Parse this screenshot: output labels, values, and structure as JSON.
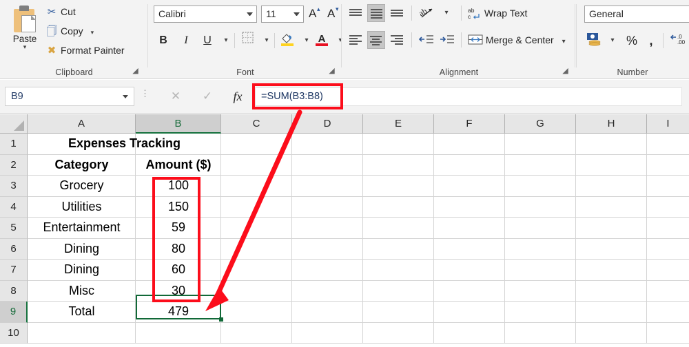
{
  "ribbon": {
    "clipboard": {
      "group_label": "Clipboard",
      "paste_label": "Paste",
      "paste_icon": "clipboard-icon",
      "items": [
        {
          "label": "Cut",
          "icon": "scissors-icon",
          "has_caret": false
        },
        {
          "label": "Copy",
          "icon": "copy-icon",
          "has_caret": true
        },
        {
          "label": "Format Painter",
          "icon": "paintbrush-icon",
          "has_caret": false
        }
      ]
    },
    "font": {
      "group_label": "Font",
      "font_name": "Calibri",
      "font_size": "11",
      "grow_font": "A",
      "shrink_font": "A",
      "bold": "B",
      "italic": "I",
      "underline": "U",
      "borders_icon": "borders-icon",
      "fill_color_icon": "fill-color-icon",
      "font_color_letter": "A",
      "fill_color": "#ffd320",
      "font_color": "#e81123"
    },
    "alignment": {
      "group_label": "Alignment",
      "wrap_text": "Wrap Text",
      "merge_center": "Merge & Center",
      "wrap_icon": "wrap-text-icon",
      "merge_icon": "merge-cells-icon",
      "orientation_icon": "text-orientation-icon",
      "decrease_indent_icon": "decrease-indent-icon",
      "increase_indent_icon": "increase-indent-icon",
      "active_vertical": "middle-align",
      "active_horizontal": "center-align"
    },
    "number": {
      "group_label": "Number",
      "format_value": "General",
      "currency_icon": "accounting-format-icon",
      "percent_label": "%",
      "comma_label": ",",
      "decrease_decimal_label": "←.0 .00"
    }
  },
  "formula_bar": {
    "name_box_value": "B9",
    "cancel_icon": "cancel-icon",
    "confirm_icon": "confirm-icon",
    "function_icon": "insert-function-icon",
    "formula_value": "=SUM(B3:B8)",
    "highlight_color": "#fc0d1b"
  },
  "sheet": {
    "columns": [
      "A",
      "B",
      "C",
      "D",
      "E",
      "F",
      "G",
      "H",
      "I"
    ],
    "selected_column": "B",
    "rows": [
      "1",
      "2",
      "3",
      "4",
      "5",
      "6",
      "7",
      "8",
      "9",
      "10"
    ],
    "selected_row": "9",
    "active_cell": "B9",
    "selection_color": "#116937",
    "cells": [
      {
        "row": 1,
        "col": "A",
        "value": "Expenses Tracking",
        "bold": true,
        "align": "center",
        "span": 2
      },
      {
        "row": 2,
        "col": "A",
        "value": "Category",
        "bold": true,
        "align": "center"
      },
      {
        "row": 2,
        "col": "B",
        "value": "Amount ($)",
        "bold": true,
        "align": "center"
      },
      {
        "row": 3,
        "col": "A",
        "value": "Grocery",
        "bold": false,
        "align": "center"
      },
      {
        "row": 3,
        "col": "B",
        "value": "100",
        "bold": false,
        "align": "center"
      },
      {
        "row": 4,
        "col": "A",
        "value": "Utilities",
        "bold": false,
        "align": "center"
      },
      {
        "row": 4,
        "col": "B",
        "value": "150",
        "bold": false,
        "align": "center"
      },
      {
        "row": 5,
        "col": "A",
        "value": "Entertainment",
        "bold": false,
        "align": "center"
      },
      {
        "row": 5,
        "col": "B",
        "value": "59",
        "bold": false,
        "align": "center"
      },
      {
        "row": 6,
        "col": "A",
        "value": "Dining",
        "bold": false,
        "align": "center"
      },
      {
        "row": 6,
        "col": "B",
        "value": "80",
        "bold": false,
        "align": "center"
      },
      {
        "row": 7,
        "col": "A",
        "value": "Dining",
        "bold": false,
        "align": "center"
      },
      {
        "row": 7,
        "col": "B",
        "value": "60",
        "bold": false,
        "align": "center"
      },
      {
        "row": 8,
        "col": "A",
        "value": "Misc",
        "bold": false,
        "align": "center"
      },
      {
        "row": 8,
        "col": "B",
        "value": "30",
        "bold": false,
        "align": "center"
      },
      {
        "row": 9,
        "col": "A",
        "value": "Total",
        "bold": false,
        "align": "center"
      },
      {
        "row": 9,
        "col": "B",
        "value": "479",
        "bold": false,
        "align": "center"
      }
    ]
  },
  "annotations": {
    "range_highlight_label": "B3:B8 red outline",
    "arrow_label": "arrow from formula bar to B9",
    "color": "#fc0d1b"
  }
}
